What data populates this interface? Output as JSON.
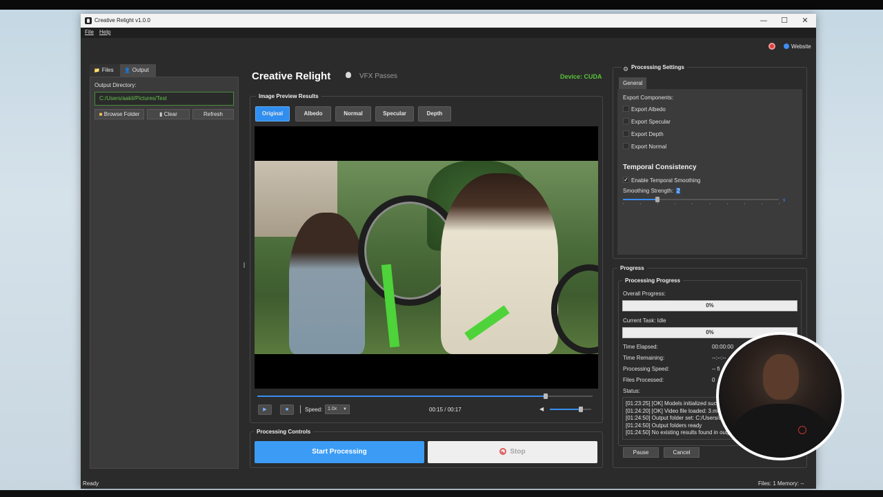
{
  "window": {
    "title": "Creative Relight v1.0.0",
    "minimize_glyph": "—",
    "maximize_glyph": "☐",
    "close_glyph": "✕"
  },
  "menu": {
    "file": "File",
    "help": "Help"
  },
  "top_right": {
    "website_label": "Website",
    "record_color": "#e23c3c",
    "globe_color": "#3d8ef5"
  },
  "left_panel": {
    "tabs": [
      {
        "label": "Files",
        "icon": "folder-icon"
      },
      {
        "label": "Output",
        "icon": "user-icon"
      }
    ],
    "active_tab": "Output",
    "output_directory_label": "Output Directory:",
    "output_directory_value": "C:/Users/aakil/Pictures/Test",
    "buttons": {
      "browse": "Browse Folder",
      "clear": "Clear",
      "refresh": "Refresh"
    }
  },
  "header": {
    "app_title": "Creative Relight",
    "subtitle": "VFX Passes",
    "device": "Device: CUDA",
    "device_color": "#58c43a"
  },
  "preview": {
    "group_title": "Image Preview  Results",
    "tabs": [
      "Original",
      "Albedo",
      "Normal",
      "Specular",
      "Depth"
    ],
    "active_tab": "Original",
    "accent_color": "#2f8ef0",
    "timeline_progress": 0.86,
    "speed_label": "Speed:",
    "speed_value": "1.0x",
    "time": "00:15 / 00:17",
    "volume": 0.75
  },
  "processing_controls": {
    "group_title": "Processing Controls",
    "start_label": "Start Processing",
    "stop_label": "Stop"
  },
  "settings": {
    "group_title": "Processing Settings",
    "tab": "General",
    "export_label": "Export Components:",
    "export_options": [
      {
        "label": "Export Albedo",
        "checked": false
      },
      {
        "label": "Export Specular",
        "checked": false
      },
      {
        "label": "Export Depth",
        "checked": false
      },
      {
        "label": "Export Normal",
        "checked": false
      }
    ],
    "temporal_title": "Temporal Consistency",
    "temporal_enable_label": "Enable Temporal Smoothing",
    "temporal_enabled": true,
    "smoothing_label": "Smoothing Strength:",
    "smoothing_value": "2",
    "smoothing_max": "9"
  },
  "progress": {
    "group_title": "Progress",
    "inner_title": "Processing Progress",
    "overall_label": "Overall Progress:",
    "overall_value": "0%",
    "current_task_label": "Current Task: Idle",
    "current_task_value": "0%",
    "time_elapsed_label": "Time Elapsed:",
    "time_elapsed_value": "00:00:00",
    "time_remaining_label": "Time Remaining:",
    "time_remaining_value": "--:--:--",
    "speed_label": "Processing Speed:",
    "speed_value": "-- fi",
    "files_label": "Files Processed:",
    "files_value": "0",
    "status_label": "Status:",
    "log": [
      "[01:23:25] [OK] Models initialized succ",
      "[01:24:20] [OK] Video file loaded: 3.mo",
      "[01:24:50] Output folder set: C:/Users/a",
      "[01:24:50] Output folders ready",
      "[01:24:50] No existing results found in outp"
    ],
    "pause_label": "Pause",
    "cancel_label": "Cancel"
  },
  "statusbar": {
    "left": "Ready",
    "right": "Files: 1  Memory: --"
  }
}
